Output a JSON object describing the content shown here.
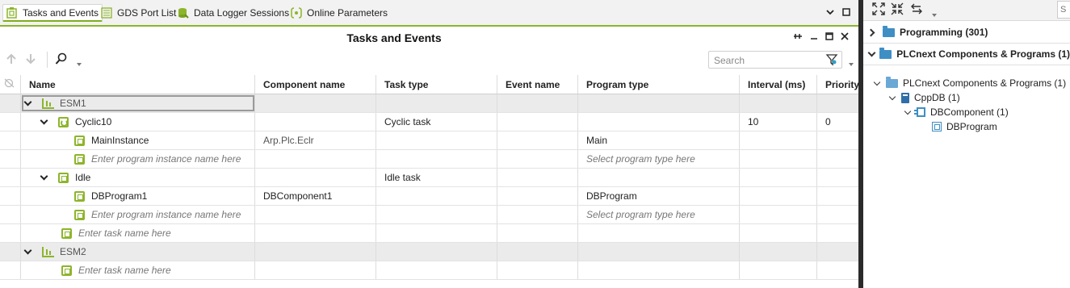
{
  "tabs": [
    {
      "label": "Tasks and Events",
      "icon": "tasks-events-icon",
      "active": true
    },
    {
      "label": "GDS Port List",
      "icon": "port-list-icon"
    },
    {
      "label": "Data Logger Sessions",
      "icon": "data-logger-icon"
    },
    {
      "label": "Online Parameters",
      "icon": "online-parameters-icon"
    }
  ],
  "editor": {
    "title": "Tasks and Events",
    "search_placeholder": "Search"
  },
  "columns": [
    "Name",
    "Component name",
    "Task type",
    "Event name",
    "Program type",
    "Interval (ms)",
    "Priority"
  ],
  "rows": [
    {
      "level": 0,
      "kind": "esm",
      "name": "ESM1",
      "expanded": true,
      "component": "",
      "task_type": "",
      "event": "",
      "program_type": "",
      "interval": "",
      "priority": ""
    },
    {
      "level": 1,
      "kind": "cyclic",
      "name": "Cyclic10",
      "expanded": true,
      "component": "",
      "task_type": "Cyclic task",
      "event": "",
      "program_type": "",
      "interval": "10",
      "priority": "0"
    },
    {
      "level": 2,
      "kind": "program",
      "name": "MainInstance",
      "component": "Arp.Plc.Eclr",
      "task_type": "",
      "event": "",
      "program_type": "Main",
      "interval": "",
      "priority": ""
    },
    {
      "level": 2,
      "kind": "program-new",
      "name": "Enter program instance name here",
      "component": "",
      "task_type": "",
      "event": "",
      "program_type": "Select program type here",
      "interval": "",
      "priority": ""
    },
    {
      "level": 1,
      "kind": "idle",
      "name": "Idle",
      "expanded": true,
      "component": "",
      "task_type": "Idle task",
      "event": "",
      "program_type": "",
      "interval": "",
      "priority": ""
    },
    {
      "level": 2,
      "kind": "program",
      "name": "DBProgram1",
      "component": "DBComponent1",
      "task_type": "",
      "event": "",
      "program_type": "DBProgram",
      "interval": "",
      "priority": ""
    },
    {
      "level": 2,
      "kind": "program-new",
      "name": "Enter program instance name here",
      "component": "",
      "task_type": "",
      "event": "",
      "program_type": "Select program type here",
      "interval": "",
      "priority": ""
    },
    {
      "level": 1,
      "kind": "task-new",
      "name": "Enter task name here",
      "component": "",
      "task_type": "",
      "event": "",
      "program_type": "",
      "interval": "",
      "priority": ""
    },
    {
      "level": 0,
      "kind": "esm",
      "name": "ESM2",
      "expanded": true,
      "component": "",
      "task_type": "",
      "event": "",
      "program_type": "",
      "interval": "",
      "priority": ""
    },
    {
      "level": 1,
      "kind": "task-new",
      "name": "Enter task name here",
      "component": "",
      "task_type": "",
      "event": "",
      "program_type": "",
      "interval": "",
      "priority": ""
    }
  ],
  "components_panel": {
    "search_placeholder": "S",
    "sections": [
      {
        "label": "Programming (301)",
        "expanded": false
      },
      {
        "label": "PLCnext Components & Programs (1)",
        "expanded": true
      }
    ],
    "tree": [
      {
        "label": "PLCnext Components & Programs (1)",
        "icon": "folder-icon"
      },
      {
        "label": "CppDB (1)",
        "icon": "library-icon"
      },
      {
        "label": "DBComponent (1)",
        "icon": "component-icon"
      },
      {
        "label": "DBProgram",
        "icon": "program-icon"
      }
    ]
  },
  "colors": {
    "accent_green": "#8cb52b",
    "folder_blue": "#3f8fc5",
    "splitter": "#2b2b2b"
  }
}
